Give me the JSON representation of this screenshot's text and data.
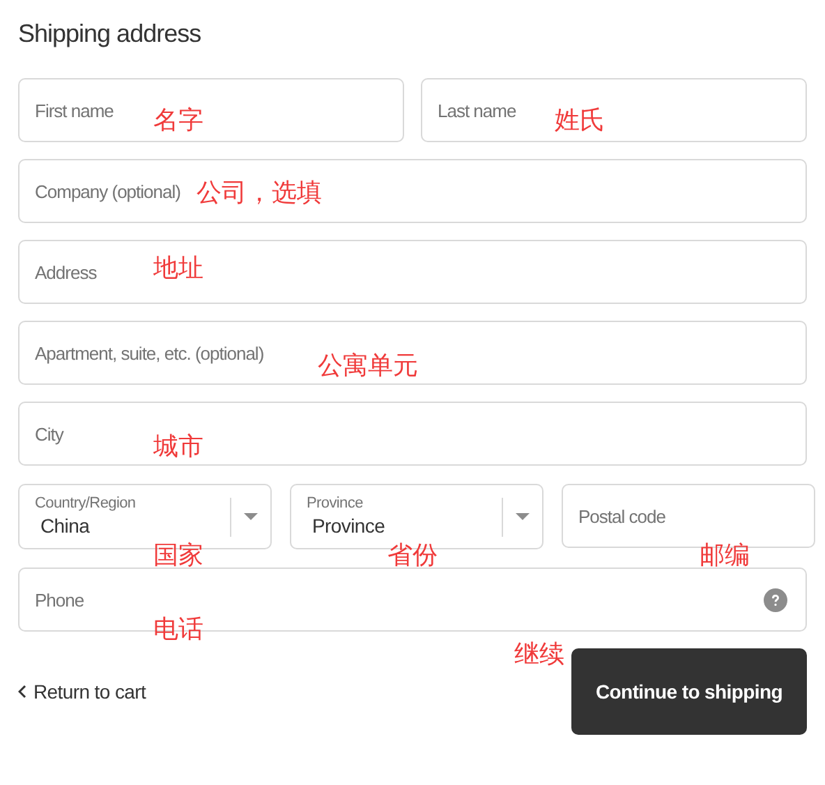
{
  "title": "Shipping address",
  "rows": [
    [
      {
        "kind": "text",
        "placeholder": "First name",
        "annotation": "名字"
      },
      {
        "kind": "text",
        "placeholder": "Last name",
        "annotation": "姓氏"
      }
    ],
    [
      {
        "kind": "text",
        "placeholder": "Company (optional)",
        "annotation": "公司，选填"
      }
    ],
    [
      {
        "kind": "text",
        "placeholder": "Address",
        "annotation": "地址"
      }
    ],
    [
      {
        "kind": "text",
        "placeholder": "Apartment, suite, etc. (optional)",
        "annotation": "公寓单元"
      }
    ],
    [
      {
        "kind": "text",
        "placeholder": "City",
        "annotation": "城市"
      }
    ],
    [
      {
        "kind": "select",
        "label": "Country/Region",
        "value": "China",
        "annotation": "国家"
      },
      {
        "kind": "select",
        "label": "Province",
        "value": "Province",
        "annotation": "省份"
      },
      {
        "kind": "text",
        "placeholder": "Postal code",
        "annotation": "邮编"
      }
    ],
    [
      {
        "kind": "help",
        "placeholder": "Phone",
        "annotation": "电话"
      }
    ]
  ],
  "return_link": "Return to cart",
  "continue_button": {
    "label": "Continue to shipping",
    "annotation": "继续"
  }
}
